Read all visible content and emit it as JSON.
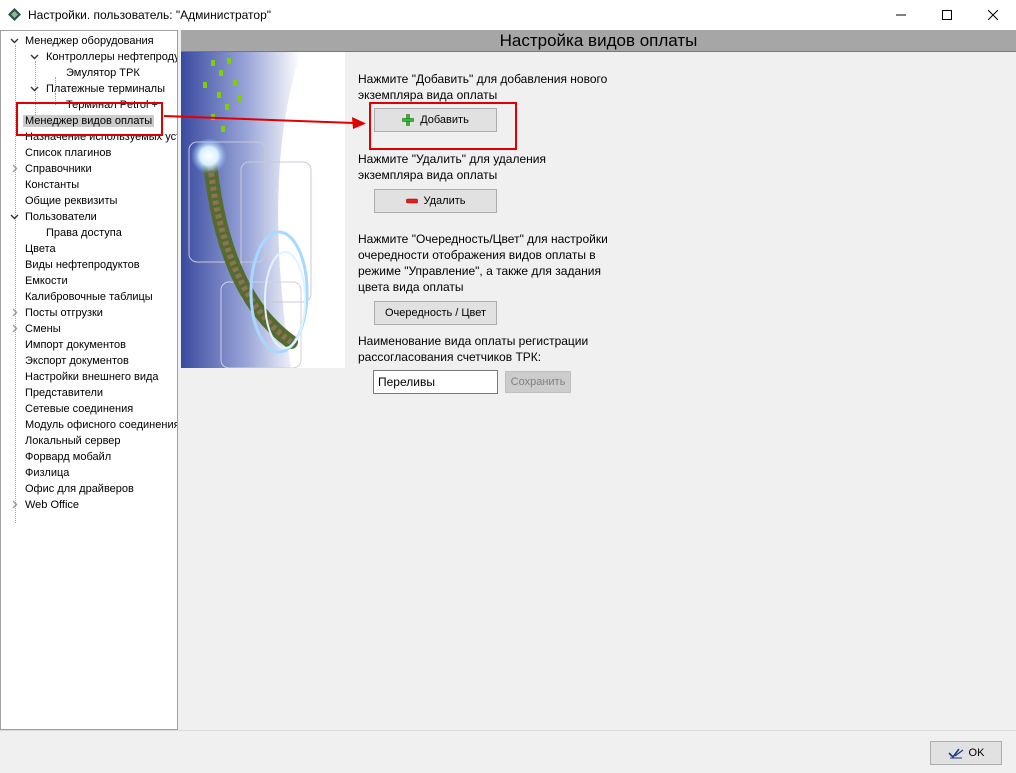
{
  "window": {
    "title": "Настройки. пользователь: \"Администратор\""
  },
  "tree": {
    "items": [
      {
        "label": "Менеджер оборудования"
      },
      {
        "label": "Контроллеры нефтепродуктов"
      },
      {
        "label": "Эмулятор ТРК"
      },
      {
        "label": "Платежные терминалы"
      },
      {
        "label": "Терминал Petrol +"
      },
      {
        "label": "Менеджер видов оплаты"
      },
      {
        "label": "Назначение используемых устройств"
      },
      {
        "label": "Список плагинов"
      },
      {
        "label": "Справочники"
      },
      {
        "label": "Константы"
      },
      {
        "label": "Общие реквизиты"
      },
      {
        "label": "Пользователи"
      },
      {
        "label": "Права доступа"
      },
      {
        "label": "Цвета"
      },
      {
        "label": "Виды нефтепродуктов"
      },
      {
        "label": "Емкости"
      },
      {
        "label": "Калибровочные таблицы"
      },
      {
        "label": "Посты отгрузки"
      },
      {
        "label": "Смены"
      },
      {
        "label": "Импорт документов"
      },
      {
        "label": "Экспорт документов"
      },
      {
        "label": "Настройки внешнего вида"
      },
      {
        "label": "Представители"
      },
      {
        "label": "Сетевые соединения"
      },
      {
        "label": "Модуль офисного соединения"
      },
      {
        "label": "Локальный сервер"
      },
      {
        "label": "Форвард мобайл"
      },
      {
        "label": "Физлица"
      },
      {
        "label": "Офис для драйверов"
      },
      {
        "label": "Web Office"
      }
    ]
  },
  "panel": {
    "title": "Настройка видов оплаты",
    "add_text_1": "Нажмите \"Добавить\" для добавления нового",
    "add_text_2": "экземпляра вида оплаты",
    "add_button": "Добавить",
    "delete_text_1": "Нажмите \"Удалить\" для удаления",
    "delete_text_2": "экземпляра вида оплаты",
    "delete_button": "Удалить",
    "order_text_1": "Нажмите \"Очередность/Цвет\" для настройки",
    "order_text_2": "очередности отображения видов оплаты в",
    "order_text_3": "режиме \"Управление\", а также для задания",
    "order_text_4": "цвета вида оплаты",
    "order_button": "Очередность / Цвет",
    "name_text_1": "Наименование вида оплаты регистрации",
    "name_text_2": "рассогласования счетчиков ТРК:",
    "name_value": "Переливы",
    "save_button": "Сохранить"
  },
  "footer": {
    "ok_button": "OK"
  },
  "colors": {
    "highlight": "#e00000",
    "header_band": "#a6a6a6",
    "selected_item": "#cccccc"
  },
  "icons": {
    "app": "diamond-icon",
    "add": "plus-icon",
    "delete": "minus-icon",
    "ok": "check-pen-icon"
  }
}
